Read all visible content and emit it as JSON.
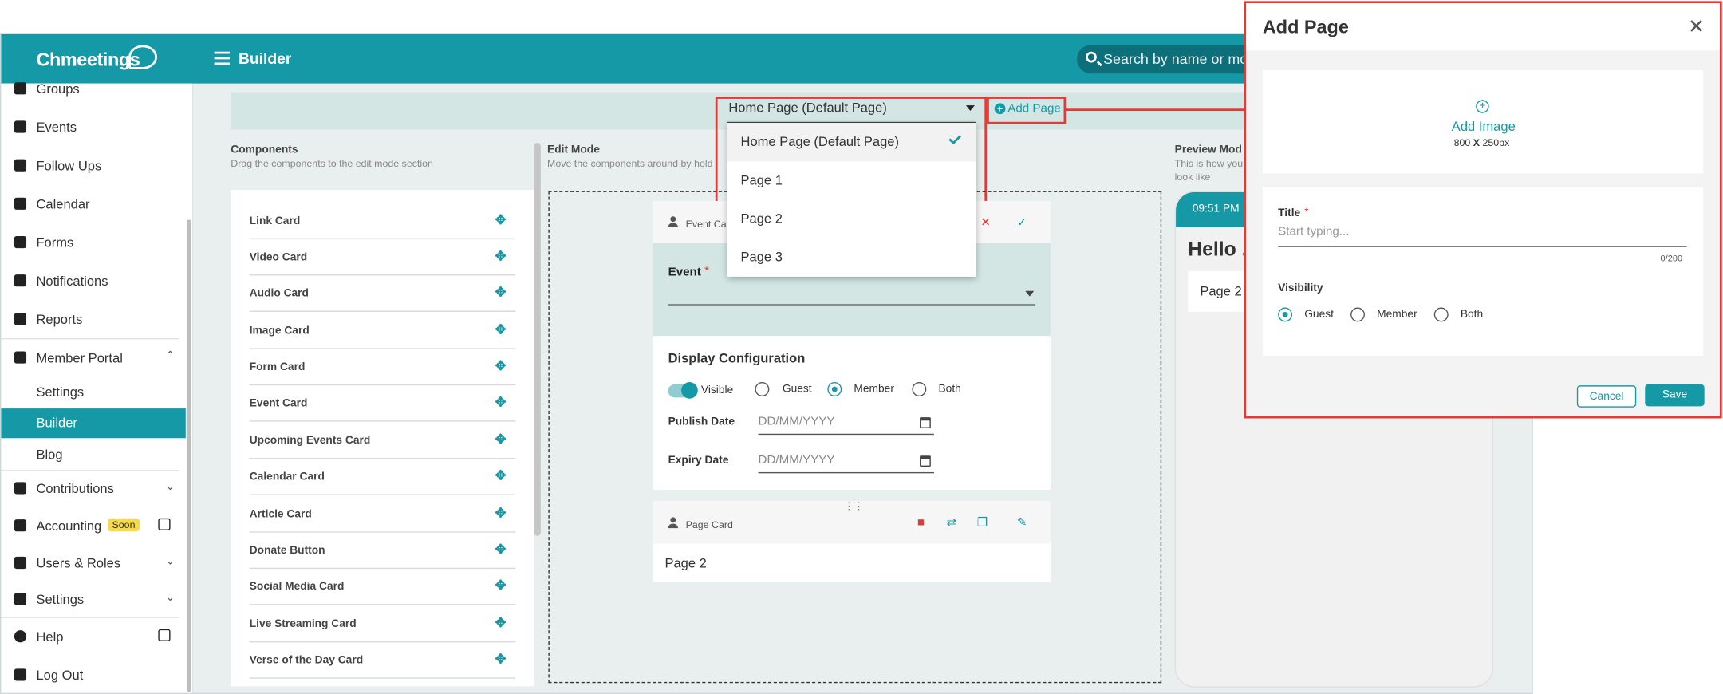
{
  "app": {
    "logo_text": "Chmeetings",
    "page_title": "Builder",
    "search_placeholder": "Search by name or mob"
  },
  "sidebar": {
    "items": [
      {
        "label": "Groups"
      },
      {
        "label": "Events"
      },
      {
        "label": "Follow Ups"
      },
      {
        "label": "Calendar"
      },
      {
        "label": "Forms"
      },
      {
        "label": "Notifications"
      },
      {
        "label": "Reports"
      },
      {
        "label": "Member Portal"
      },
      {
        "label": "Settings"
      },
      {
        "label": "Builder"
      },
      {
        "label": "Blog"
      },
      {
        "label": "Contributions"
      },
      {
        "label": "Accounting",
        "badge": "Soon"
      },
      {
        "label": "Users & Roles"
      },
      {
        "label": "Settings"
      },
      {
        "label": "Help"
      },
      {
        "label": "Log Out"
      }
    ]
  },
  "page_selector": {
    "selected": "Home Page (Default Page)",
    "add_label": "Add Page",
    "options": [
      "Home Page (Default Page)",
      "Page 1",
      "Page 2",
      "Page 3"
    ]
  },
  "components": {
    "title": "Components",
    "subtitle": "Drag the components to the edit mode section",
    "items": [
      "Link Card",
      "Video Card",
      "Audio Card",
      "Image Card",
      "Form Card",
      "Event Card",
      "Upcoming Events Card",
      "Calendar Card",
      "Article Card",
      "Donate Button",
      "Social Media Card",
      "Live Streaming Card",
      "Verse of the Day Card"
    ]
  },
  "edit_mode": {
    "title": "Edit Mode",
    "subtitle": "Move the components around by hold",
    "event_card": {
      "header": "Event Ca",
      "field_label": "Event",
      "display_config_title": "Display Configuration",
      "visible_label": "Visible",
      "visibility_options": [
        "Guest",
        "Member",
        "Both"
      ],
      "selected_visibility": "Member",
      "publish_label": "Publish Date",
      "expiry_label": "Expiry Date",
      "date_placeholder": "DD/MM/YYYY"
    },
    "page_card": {
      "header": "Page Card",
      "body": "Page 2"
    }
  },
  "preview": {
    "title": "Preview Mod",
    "subtitle_line1": "This is how you",
    "subtitle_line2": "look like",
    "time": "09:51 PM",
    "greeting": "Hello .",
    "card_text": "Page 2"
  },
  "modal": {
    "title": "Add Page",
    "add_image_label": "Add Image",
    "image_size_a": "800",
    "image_size_x": "X",
    "image_size_b": "250px",
    "title_label": "Title",
    "required_mark": "*",
    "title_placeholder": "Start typing...",
    "char_counter": "0/200",
    "visibility_label": "Visibility",
    "visibility_options": [
      "Guest",
      "Member",
      "Both"
    ],
    "selected_visibility": "Guest",
    "cancel_label": "Cancel",
    "save_label": "Save"
  },
  "colors": {
    "brand": "#1699a6",
    "highlight": "#e53935",
    "delete": "#e53935"
  }
}
